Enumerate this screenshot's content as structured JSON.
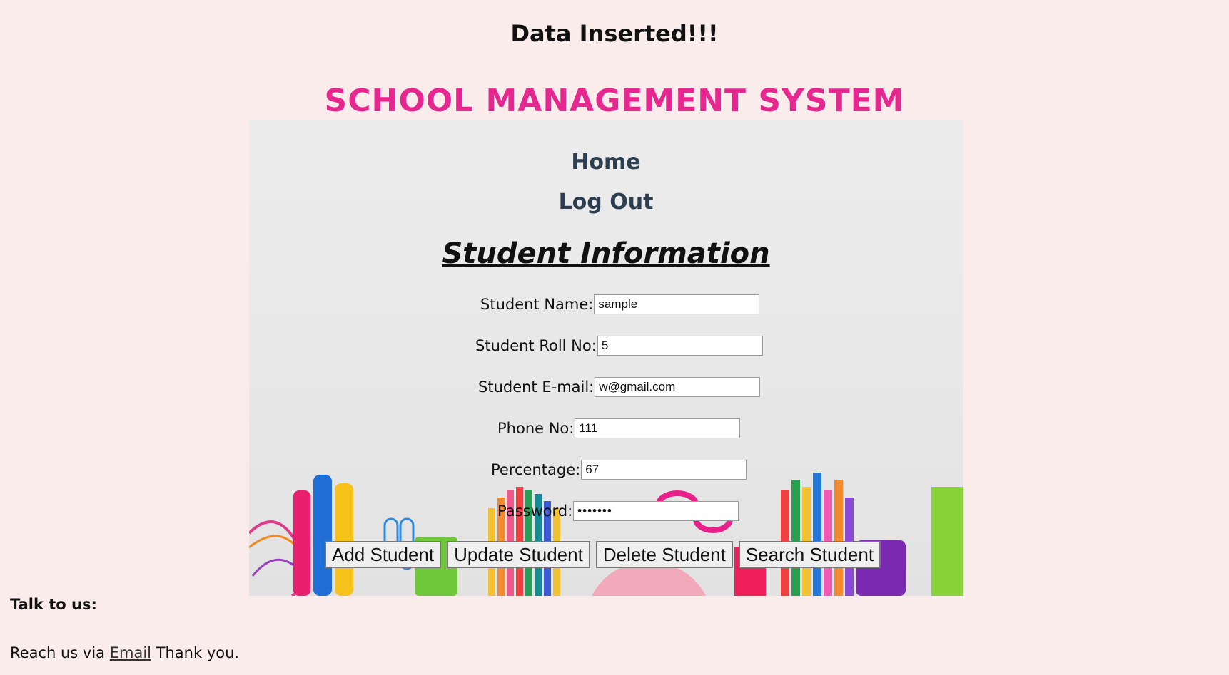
{
  "status_message": "Data Inserted!!!",
  "app_title": "SCHOOL MANAGEMENT SYSTEM",
  "nav": {
    "home": "Home",
    "logout": "Log Out"
  },
  "form": {
    "title": "Student Information",
    "fields": {
      "name": {
        "label": "Student Name:",
        "value": "sample"
      },
      "roll": {
        "label": "Student Roll No:",
        "value": "5"
      },
      "email": {
        "label": "Student E-mail:",
        "value": "w@gmail.com"
      },
      "phone": {
        "label": "Phone No:",
        "value": "111"
      },
      "percentage": {
        "label": "Percentage:",
        "value": "67"
      },
      "password": {
        "label": "Password:",
        "value": "•••••••"
      }
    },
    "buttons": {
      "add": "Add Student",
      "update": "Update Student",
      "delete": "Delete Student",
      "search": "Search Student"
    }
  },
  "footer": {
    "heading": "Talk to us:",
    "prefix": "Reach us via",
    "link": "Email",
    "suffix": "Thank you."
  },
  "colors": {
    "page_background": "#fbecec",
    "title": "#e6278f",
    "nav": "#2c3e50"
  }
}
